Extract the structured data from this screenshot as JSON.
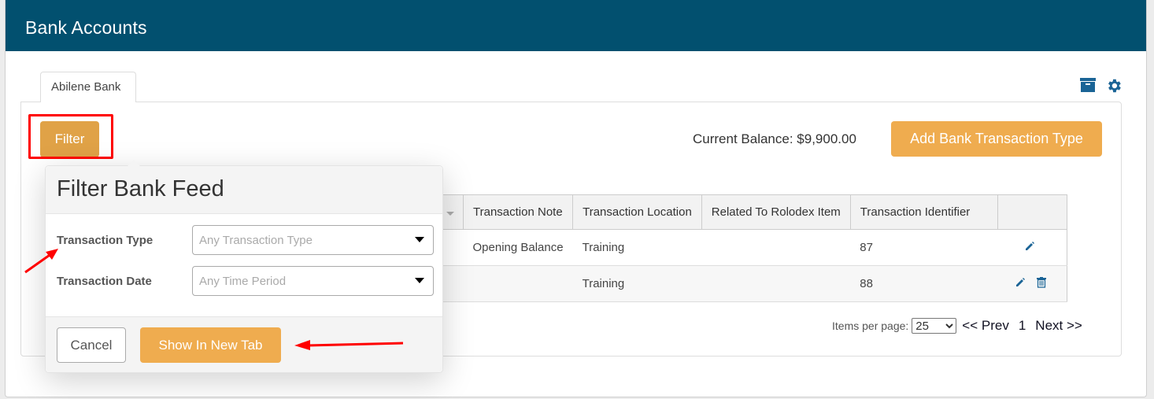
{
  "header": {
    "title": "Bank Accounts"
  },
  "tabs": [
    {
      "label": "Abilene Bank",
      "active": true
    }
  ],
  "toolbar": {
    "archive_icon": "archive-icon",
    "settings_icon": "gear-icon",
    "filter_label": "Filter",
    "balance_text": "Current Balance: $9,900.00",
    "add_type_label": "Add Bank Transaction Type"
  },
  "colors": {
    "header_bg": "#02506f",
    "accent_orange": "#efac4f",
    "filter_orange": "#e0a247",
    "icon_blue": "#1a6496",
    "annotation_red": "#ff0000"
  },
  "table": {
    "columns": [
      "",
      "Transaction Note",
      "Transaction Location",
      "Related To Rolodex Item",
      "Transaction Identifier",
      ""
    ],
    "rows": [
      {
        "note": "Opening Balance",
        "location": "Training",
        "rolodex": "",
        "identifier": "87",
        "actions": [
          "edit"
        ]
      },
      {
        "note": "",
        "location": "Training",
        "rolodex": "",
        "identifier": "88",
        "actions": [
          "edit",
          "delete"
        ]
      }
    ]
  },
  "pagination": {
    "items_per_page_label": "Items per page:",
    "items_per_page": "25",
    "prev_label": "<< Prev",
    "page": "1",
    "next_label": "Next >>"
  },
  "filter_popover": {
    "title": "Filter Bank Feed",
    "fields": [
      {
        "label": "Transaction Type",
        "placeholder": "Any Transaction Type"
      },
      {
        "label": "Transaction Date",
        "placeholder": "Any Time Period"
      }
    ],
    "cancel_label": "Cancel",
    "submit_label": "Show In New Tab"
  }
}
